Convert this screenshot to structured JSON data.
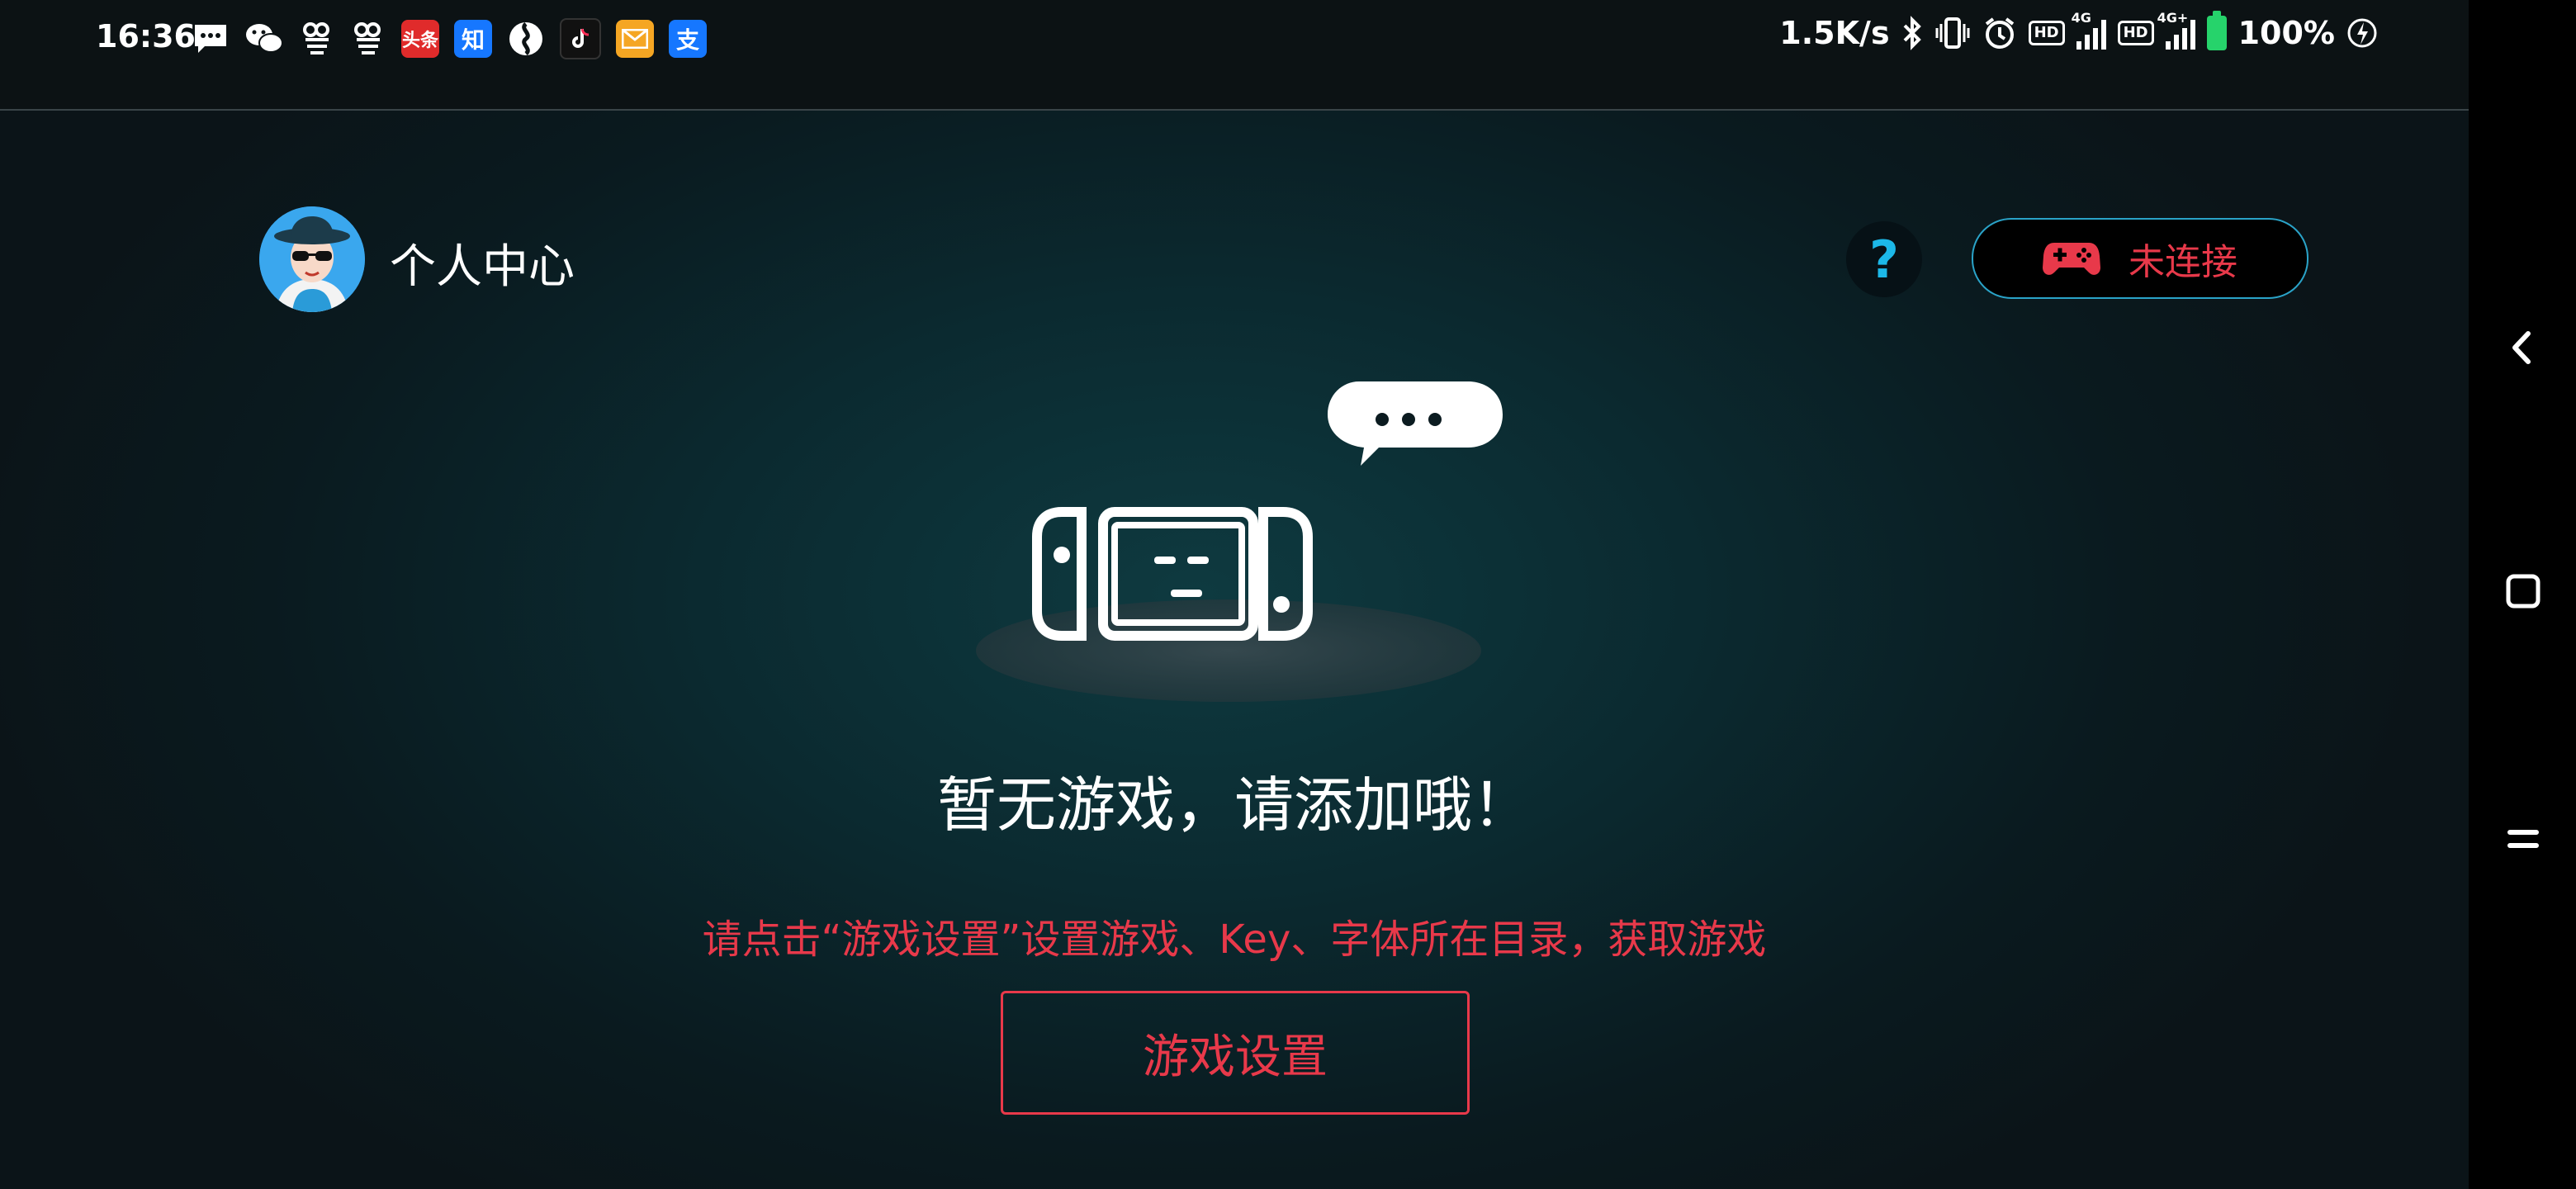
{
  "status_bar": {
    "time": "16:36",
    "notification_icons": [
      "message-icon",
      "wechat-icon",
      "hd-icon",
      "hd-icon",
      "toutiao-icon",
      "zhihu-icon",
      "soul-icon",
      "tiktok-icon",
      "mail-icon",
      "alipay-icon"
    ],
    "toutiao_label": "头条",
    "zhihu_label": "知",
    "alipay_label": "支",
    "net_speed": "1.5K/s",
    "hd1": "HD",
    "net1": "4G",
    "hd2": "HD",
    "net2": "4G+",
    "battery": "100%",
    "battery_color": "#26d36b"
  },
  "header": {
    "profile_label": "个人中心",
    "help_label": "?",
    "connection_label": "未连接"
  },
  "empty_state": {
    "title": "暂无游戏，请添加哦！",
    "hint": "请点击“游戏设置”设置游戏、Key、字体所在目录，获取游戏",
    "button_label": "游戏设置"
  },
  "nav_bar": {
    "buttons": [
      "back-icon",
      "home-icon",
      "menu-icon"
    ]
  },
  "colors": {
    "accent_red": "#e8394a",
    "accent_blue": "#1cb8e8",
    "background": "#0b2a30"
  }
}
